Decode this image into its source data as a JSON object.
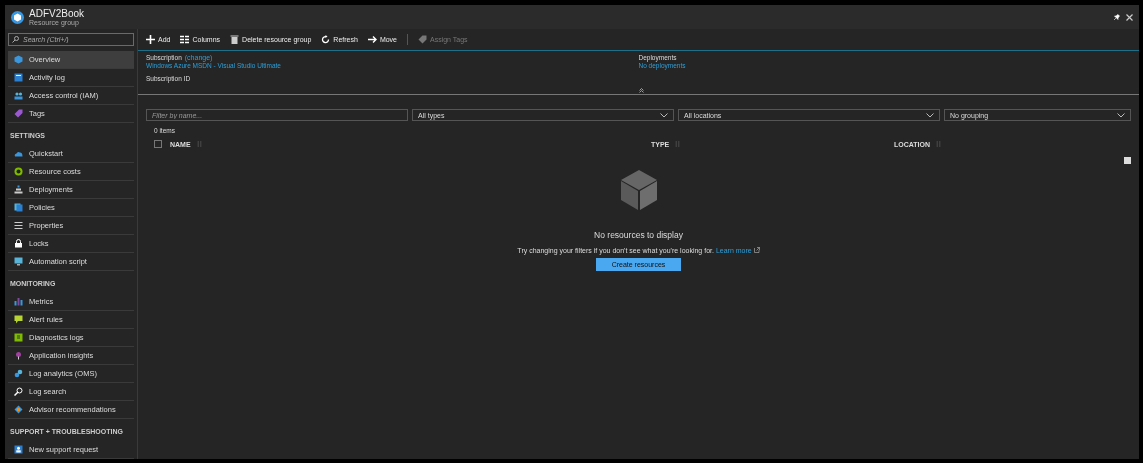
{
  "window": {
    "title": "ADFV2Book",
    "subtitle": "Resource group"
  },
  "sidebar": {
    "search": {
      "placeholder": "Search (Ctrl+/)"
    },
    "sections": [
      {
        "items": [
          {
            "label": "Overview",
            "selected": true
          },
          {
            "label": "Activity log",
            "selected": false
          },
          {
            "label": "Access control (IAM)",
            "selected": false
          },
          {
            "label": "Tags",
            "selected": false
          }
        ]
      },
      {
        "heading": "SETTINGS",
        "items": [
          {
            "label": "Quickstart",
            "selected": false
          },
          {
            "label": "Resource costs",
            "selected": false
          },
          {
            "label": "Deployments",
            "selected": false
          },
          {
            "label": "Policies",
            "selected": false
          },
          {
            "label": "Properties",
            "selected": false
          },
          {
            "label": "Locks",
            "selected": false
          },
          {
            "label": "Automation script",
            "selected": false
          }
        ]
      },
      {
        "heading": "MONITORING",
        "items": [
          {
            "label": "Metrics",
            "selected": false
          },
          {
            "label": "Alert rules",
            "selected": false
          },
          {
            "label": "Diagnostics logs",
            "selected": false
          },
          {
            "label": "Application insights",
            "selected": false
          },
          {
            "label": "Log analytics (OMS)",
            "selected": false
          },
          {
            "label": "Log search",
            "selected": false
          },
          {
            "label": "Advisor recommendations",
            "selected": false
          }
        ]
      },
      {
        "heading": "SUPPORT + TROUBLESHOOTING",
        "items": [
          {
            "label": "New support request",
            "selected": false
          }
        ]
      }
    ]
  },
  "toolbar": [
    {
      "label": "Add",
      "disabled": false
    },
    {
      "label": "Columns",
      "disabled": false
    },
    {
      "label": "Delete resource group",
      "disabled": false
    },
    {
      "label": "Refresh",
      "disabled": false
    },
    {
      "label": "Move",
      "disabled": false
    },
    {
      "label": "Assign Tags",
      "disabled": true
    }
  ],
  "essentials": {
    "subscription_label": "Subscription",
    "change_link": "(change)",
    "subscription": "Windows Azure MSDN - Visual Studio Ultimate",
    "subscription_id_label": "Subscription ID",
    "deployments_label": "Deployments",
    "deployments": "No deployments"
  },
  "filters": {
    "name": {
      "placeholder": "Filter by name..."
    },
    "dropdowns": [
      "All types",
      "All locations",
      "No grouping"
    ]
  },
  "count": "0 items",
  "table": {
    "select_all_checked": false,
    "columns": [
      "NAME",
      "TYPE",
      "LOCATION"
    ]
  },
  "empty_state": {
    "title": "No resources to display",
    "message": "Try changing your filters if you don't see what you're looking for.",
    "link": "Learn more",
    "button": "Create resources"
  }
}
